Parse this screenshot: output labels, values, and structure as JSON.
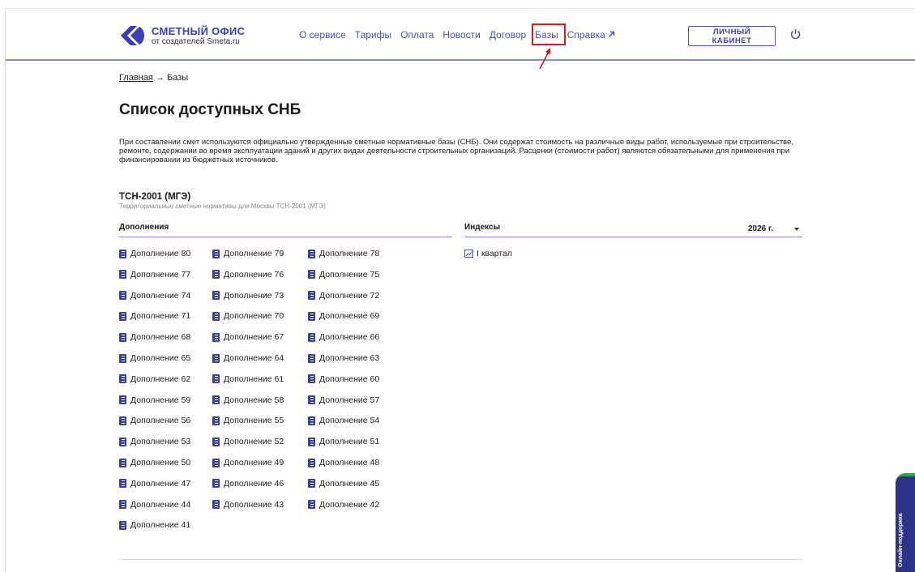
{
  "header": {
    "logo_title": "СМЕТНЫЙ ОФИС",
    "logo_subtitle": "от создателей Smeta.ru",
    "nav": [
      "О сервисе",
      "Тарифы",
      "Оплата",
      "Новости",
      "Договор",
      "Базы",
      "Справка"
    ],
    "nav_external_icon": "arrow-up-right-icon",
    "cabinet_label": "ЛИЧНЫЙ КАБИНЕТ",
    "accent_color": "#4a4fc4",
    "highlight_color": "#e01717"
  },
  "breadcrumb": {
    "home": "Главная",
    "separator": "→",
    "current": "Базы"
  },
  "page_title": "Список доступных СНБ",
  "intro": "При составлении смет используются официально утвержденные сметные нормативные базы (СНБ). Они содержат стоимость на различные виды работ, используемые при строительстве, ремонте, содержании во время эксплуатации зданий и других видах деятельности строительных организаций. Расценки (стоимости работ) являются обязательными для применения при финансировании из бюджетных источников.",
  "base": {
    "title": "ТСН-2001 (МГЭ)",
    "subtitle": "Территориальные сметные нормативы для Москвы ТСН-2001 (МГЭ)"
  },
  "supplements": {
    "header": "Дополнения",
    "items": [
      "Дополнение 80",
      "Дополнение 79",
      "Дополнение 78",
      "Дополнение 77",
      "Дополнение 76",
      "Дополнение 75",
      "Дополнение 74",
      "Дополнение 73",
      "Дополнение 72",
      "Дополнение 71",
      "Дополнение 70",
      "Дополнение 69",
      "Дополнение 68",
      "Дополнение 67",
      "Дополнение 66",
      "Дополнение 65",
      "Дополнение 64",
      "Дополнение 63",
      "Дополнение 62",
      "Дополнение 61",
      "Дополнение 60",
      "Дополнение 59",
      "Дополнение 58",
      "Дополнение 57",
      "Дополнение 56",
      "Дополнение 55",
      "Дополнение 54",
      "Дополнение 53",
      "Дополнение 52",
      "Дополнение 51",
      "Дополнение 50",
      "Дополнение 49",
      "Дополнение 48",
      "Дополнение 47",
      "Дополнение 46",
      "Дополнение 45",
      "Дополнение 44",
      "Дополнение 43",
      "Дополнение 42",
      "Дополнение 41"
    ]
  },
  "indices": {
    "header": "Индексы",
    "year": "2026 г.",
    "items": [
      "I квартал"
    ]
  },
  "support_widget": {
    "label": "Онлайн-поддержка"
  }
}
